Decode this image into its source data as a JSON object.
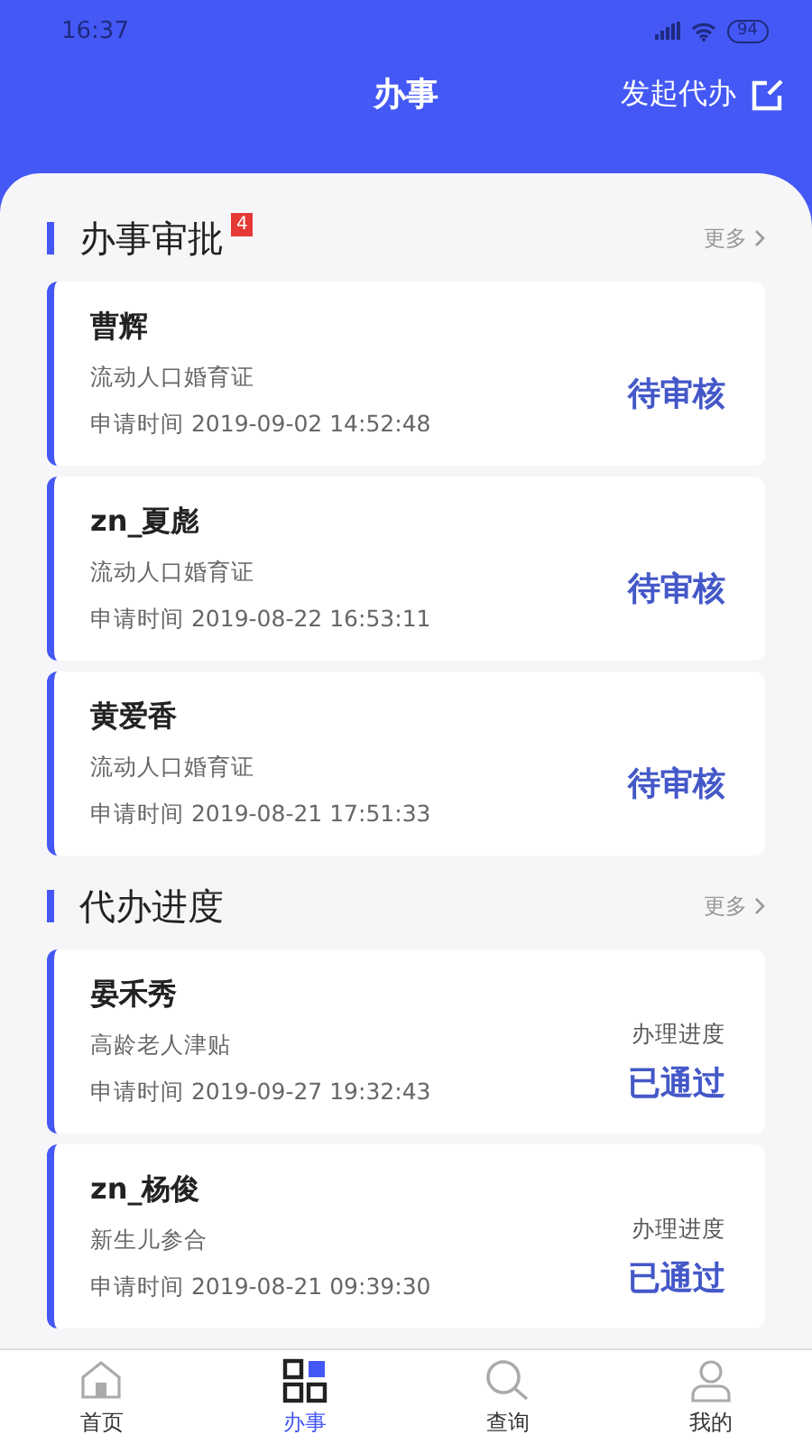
{
  "status_bar": {
    "time": "16:37",
    "battery": "94"
  },
  "header": {
    "title": "办事",
    "action": "发起代办"
  },
  "sections": [
    {
      "title": "办事审批",
      "badge": "4",
      "more": "更多",
      "cards": [
        {
          "name": "曹辉",
          "item": "流动人口婚育证",
          "time": "申请时间 2019-09-02 14:52:48",
          "status": "待审核"
        },
        {
          "name": "zn_夏彪",
          "item": "流动人口婚育证",
          "time": "申请时间 2019-08-22 16:53:11",
          "status": "待审核"
        },
        {
          "name": "黄爱香",
          "item": "流动人口婚育证",
          "time": "申请时间 2019-08-21 17:51:33",
          "status": "待审核"
        }
      ]
    },
    {
      "title": "代办进度",
      "more": "更多",
      "cards": [
        {
          "name": "晏禾秀",
          "item": "高龄老人津贴",
          "time": "申请时间 2019-09-27 19:32:43",
          "status_label": "办理进度",
          "status": "已通过"
        },
        {
          "name": "zn_杨俊",
          "item": "新生儿参合",
          "time": "申请时间 2019-08-21 09:39:30",
          "status_label": "办理进度",
          "status": "已通过"
        }
      ]
    }
  ],
  "tabs": [
    {
      "label": "首页",
      "kind": "home",
      "selected": false
    },
    {
      "label": "办事",
      "kind": "grid",
      "selected": true
    },
    {
      "label": "查询",
      "kind": "search",
      "selected": false
    },
    {
      "label": "我的",
      "kind": "user",
      "selected": false
    }
  ]
}
